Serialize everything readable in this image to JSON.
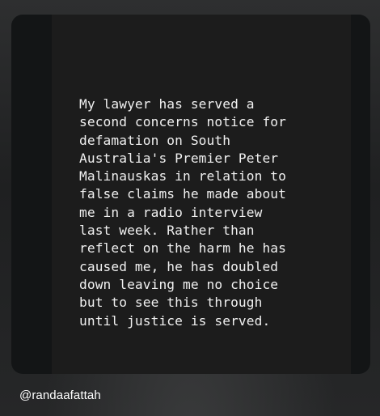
{
  "post": {
    "text_lines": [
      "My lawyer has served a",
      "second concerns notice for",
      "defamation on South",
      "Australia's Premier Peter",
      "Malinauskas in relation to",
      "false claims he made about",
      "me in a radio interview",
      "last week. Rather than",
      "reflect on the harm he has",
      "caused me, he has doubled",
      "down leaving me no choice",
      "but to see this through",
      "until justice is served."
    ]
  },
  "attribution": {
    "handle": "@randaafattah"
  },
  "colors": {
    "page_background": "#232425",
    "card_background": "#131516",
    "panel_background": "#1c1c1c",
    "text": "#f0f0f0"
  }
}
